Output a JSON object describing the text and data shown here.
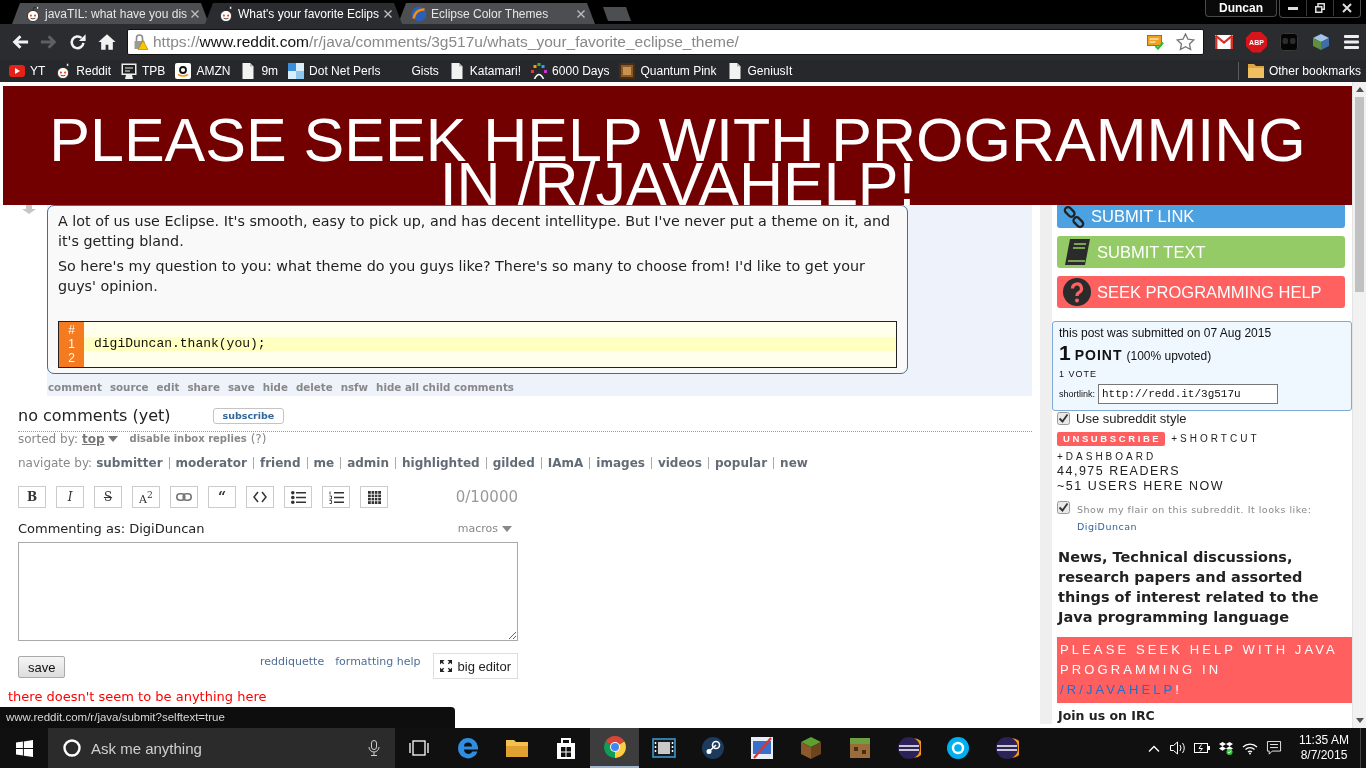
{
  "browser": {
    "tabs": [
      {
        "title": "javaTIL: what have you dis",
        "selected": false
      },
      {
        "title": "What's your favorite Eclips",
        "selected": true
      },
      {
        "title": "Eclipse Color Themes",
        "selected": false
      }
    ],
    "profile": "Duncan",
    "nav_buttons": [
      {
        "kind": "back",
        "disabled": false
      },
      {
        "kind": "forward",
        "disabled": true
      },
      {
        "kind": "reload",
        "disabled": false
      },
      {
        "kind": "home",
        "disabled": false
      }
    ],
    "address": {
      "scheme": "https://",
      "host": "www.reddit.com",
      "path": "/r/java/comments/3g517u/whats_your_favorite_eclipse_theme/"
    },
    "extension_label": "ABP",
    "bookmarks": [
      "YT",
      "Reddit",
      "TPB",
      "AMZN",
      "9m",
      "Dot Net Perls",
      "Gists",
      "Katamari!",
      "6000 Days",
      "Quantum Pink",
      "GeniusIt"
    ],
    "other_bookmarks": "Other bookmarks"
  },
  "banner": "PLEASE SEEK HELP WITH PROGRAMMING IN /R/JAVAHELP!",
  "post": {
    "paragraphs": [
      "A lot of us use Eclipse. It's smooth, easy to pick up, and has decent intellitype. But I've never put a theme on it, and it's getting bland.",
      "So here's my question to you: what theme do you guys like? There's so many to choose from! I'd like to get your guys' opinion."
    ],
    "code": {
      "header": "#",
      "lines": [
        {
          "number": "1",
          "text": "digiDuncan.thank(you);",
          "highlighted": true
        },
        {
          "number": "2",
          "highlighted": false
        }
      ]
    },
    "actions": [
      "comment",
      "source",
      "edit",
      "share",
      "save",
      "hide",
      "delete",
      "nsfw",
      "hide all child comments"
    ]
  },
  "comments": {
    "title": "no comments (yet)",
    "subscribe": "subscribe",
    "sorted_label": "sorted by:",
    "sort_value": "top",
    "disable_replies": "disable inbox replies",
    "help": "(?)",
    "navigate_label": "navigate by:",
    "navigate_links": [
      "submitter",
      "moderator",
      "friend",
      "me",
      "admin",
      "highlighted",
      "gilded",
      "IAmA",
      "images",
      "videos",
      "popular",
      "new"
    ],
    "editor": {
      "format_buttons": [
        {
          "kind": "bold",
          "label": "B"
        },
        {
          "kind": "italic",
          "label": "I"
        },
        {
          "kind": "strike",
          "label": "S"
        },
        {
          "kind": "superscript",
          "label": "A$^{2}$"
        },
        {
          "kind": "link"
        },
        {
          "kind": "quote",
          "label": "“"
        },
        {
          "kind": "code"
        },
        {
          "kind": "bullets"
        },
        {
          "kind": "numbers"
        },
        {
          "kind": "table"
        }
      ],
      "counter": "0/10000",
      "commenting_as": "Commenting as: DigiDuncan",
      "macros": "macros",
      "save": "save",
      "links": [
        "reddiquette",
        "formatting help"
      ],
      "big_editor": "big editor"
    },
    "empty_notice": "there doesn't seem to be anything here"
  },
  "sidebar": {
    "buttons": [
      {
        "kind": "link",
        "label": "SUBMIT LINK",
        "color": "#4ca1e0"
      },
      {
        "kind": "text",
        "label": "SUBMIT TEXT",
        "color": "#94cb66"
      },
      {
        "kind": "help",
        "label": "SEEK PROGRAMMING HELP",
        "color": "#ff6060"
      }
    ],
    "info": {
      "submitted": "this post was submitted on 07 Aug 2015",
      "points": "1",
      "points_label": "POINT",
      "upvoted": "(100% upvoted)",
      "votes": "1 VOTE",
      "shortlink_label": "shortlink:",
      "shortlink": "http://redd.it/3g517u"
    },
    "style_option": {
      "label": "Use subreddit style",
      "checked": true
    },
    "unsubscribe": "UNSUBSCRIBE",
    "shortcut": "+SHORTCUT",
    "dashboard": "+DASHBOARD",
    "readers": "44,975 READERS",
    "online": "~51 USERS HERE NOW",
    "flair": {
      "checked": true,
      "label": "Show my flair on this subreddit. It looks like:",
      "name": "DigiDuncan"
    },
    "description": "News, Technical discussions, research papers and assorted things of interest related to the Java programming language",
    "notice": {
      "before": "PLEASE SEEK HELP WITH JAVA PROGRAMMING IN",
      "link": "/R/JAVAHELP",
      "after": "!"
    },
    "irc": "Join us on IRC"
  },
  "status_url": "www.reddit.com/r/java/submit?selftext=true",
  "taskbar": {
    "search_placeholder": "Ask me anything",
    "apps": [
      {
        "selected": false
      },
      {
        "selected": false
      },
      {
        "selected": false
      },
      {
        "selected": true
      },
      {
        "selected": false
      },
      {
        "selected": false
      },
      {
        "selected": false
      },
      {
        "selected": false
      },
      {
        "selected": false
      },
      {
        "selected": false
      },
      {
        "selected": false
      },
      {
        "selected": false
      }
    ],
    "time": "11:35 AM",
    "date": "8/7/2015"
  }
}
